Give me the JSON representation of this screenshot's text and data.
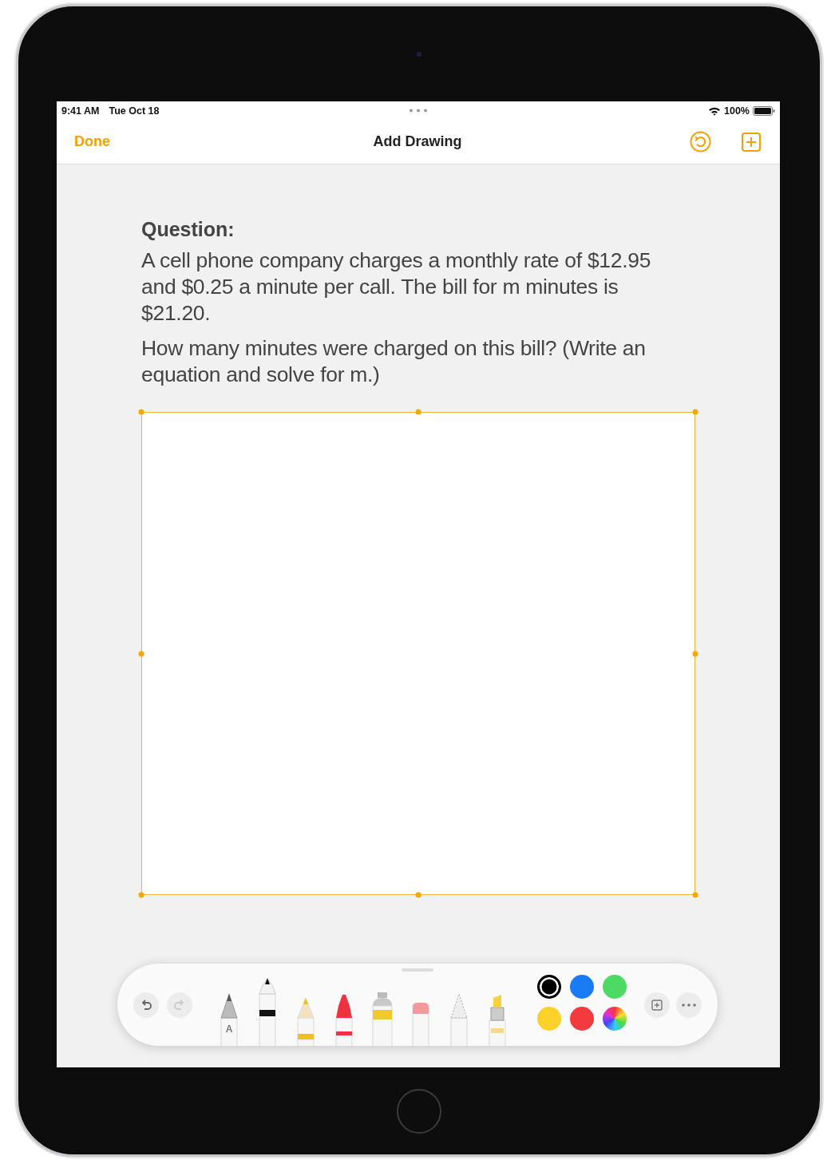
{
  "status_bar": {
    "time": "9:41 AM",
    "date": "Tue Oct 18",
    "battery": "100%"
  },
  "nav_bar": {
    "done": "Done",
    "title": "Add Drawing"
  },
  "question": {
    "heading": "Question:",
    "paragraphs": [
      "A cell phone company charges a monthly rate of $12.95 and $0.25 a minute per call. The bill for m minutes is $21.20.",
      "How many minutes were charged on this bill? (Write an equation and solve for m.)"
    ]
  },
  "canvas": {
    "selected": true
  },
  "toolbar": {
    "undo_enabled": true,
    "redo_enabled": false,
    "tools": [
      {
        "kind": "monoline",
        "label": "A",
        "selected": false
      },
      {
        "kind": "pen",
        "selected": true
      },
      {
        "kind": "pencil",
        "selected": false
      },
      {
        "kind": "crayon",
        "selected": false
      },
      {
        "kind": "fill",
        "selected": false
      },
      {
        "kind": "eraser",
        "selected": false
      },
      {
        "kind": "lasso",
        "selected": false
      },
      {
        "kind": "marker",
        "selected": false
      }
    ],
    "colors": [
      {
        "kind": "swatch",
        "color": "#000000",
        "selected": true
      },
      {
        "kind": "swatch",
        "color": "#1a7cf5",
        "selected": false
      },
      {
        "kind": "swatch",
        "color": "#4cd964",
        "selected": false
      },
      {
        "kind": "swatch",
        "color": "#fcd12a",
        "selected": false
      },
      {
        "kind": "swatch",
        "color": "#f23a3f",
        "selected": false
      },
      {
        "kind": "picker",
        "selected": false
      }
    ]
  }
}
